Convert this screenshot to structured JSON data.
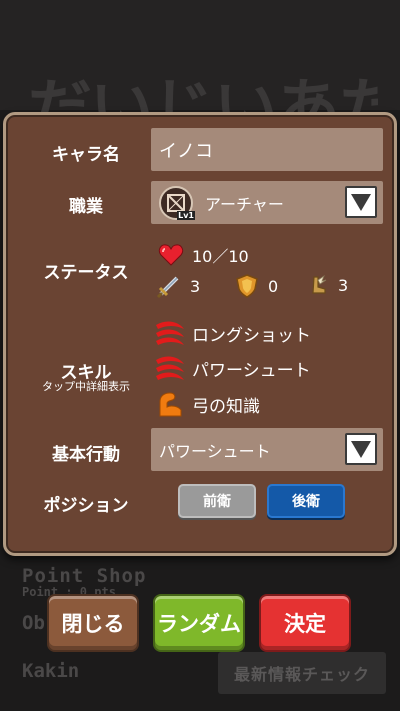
{
  "background": {
    "title": "だいじいあたく",
    "point_shop": "Point Shop",
    "points": "Point : 0 pts",
    "menu_ob": "Ob",
    "kakin": "Kakin",
    "news_button": "最新情報チェック"
  },
  "form": {
    "name_label": "キャラ名",
    "name_value": "イノコ",
    "class_label": "職業",
    "class_value": "アーチャー",
    "class_icon_level": "Lv1",
    "status_label": "ステータス",
    "hp": "10／10",
    "attack": "3",
    "defense": "0",
    "speed": "3",
    "skill_label": "スキル",
    "skill_hint": "タップ中詳細表示",
    "skills": [
      {
        "name": "ロングショット",
        "icon": "red-claw-icon"
      },
      {
        "name": "パワーシュート",
        "icon": "red-claw-icon"
      },
      {
        "name": "弓の知識",
        "icon": "orange-arm-icon"
      }
    ],
    "action_label": "基本行動",
    "action_value": "パワーシュート",
    "position_label": "ポジション",
    "position_front": "前衛",
    "position_back": "後衛",
    "position_selected": "後衛"
  },
  "buttons": {
    "close": "閉じる",
    "random": "ランダム",
    "confirm": "決定"
  },
  "colors": {
    "panel": "#6a4433",
    "field": "#a58a7a",
    "front_btn": "#9a9a9a",
    "back_btn": "#1459a8",
    "close_btn": "#8c5a3c",
    "random_btn": "#7fb82a",
    "confirm_btn": "#e53232"
  }
}
